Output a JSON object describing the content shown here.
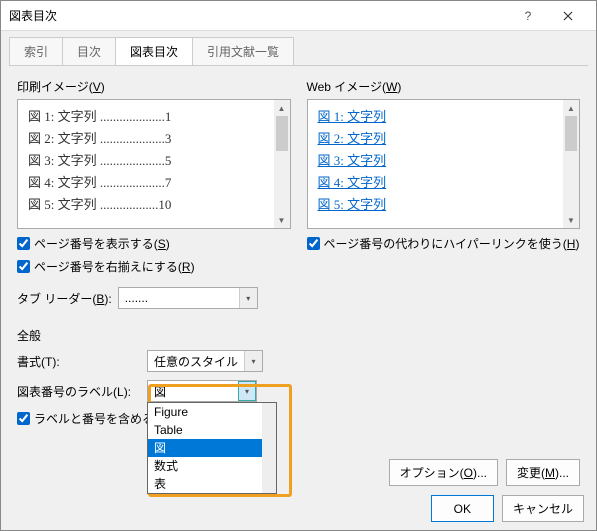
{
  "dialog": {
    "title": "図表目次"
  },
  "tabs": {
    "t1": "索引",
    "t2": "目次",
    "t3": "図表目次",
    "t4": "引用文献一覧"
  },
  "printPreview": {
    "label_pre": "印刷イメージ(",
    "label_u": "V",
    "label_post": ")",
    "lines": [
      "図 1: 文字列 ....................1",
      "図 2: 文字列 ....................3",
      "図 3: 文字列 ....................5",
      "図 4: 文字列 ....................7",
      "図 5: 文字列 ..................10"
    ]
  },
  "webPreview": {
    "label_pre": "Web イメージ(",
    "label_u": "W",
    "label_post": ")",
    "lines": [
      "図 1: 文字列",
      "図 2: 文字列",
      "図 3: 文字列",
      "図 4: 文字列",
      "図 5: 文字列"
    ]
  },
  "checks": {
    "showPage_pre": "ページ番号を表示する(",
    "showPage_u": "S",
    "showPage_post": ")",
    "rightAlign_pre": "ページ番号を右揃えにする(",
    "rightAlign_u": "R",
    "rightAlign_post": ")",
    "hyperlink_pre": "ページ番号の代わりにハイパーリンクを使う(",
    "hyperlink_u": "H",
    "hyperlink_post": ")"
  },
  "tabLeader": {
    "label_pre": "タブ リーダー(",
    "label_u": "B",
    "label_post": "):",
    "value": "......."
  },
  "general": {
    "title": "全般",
    "format_label_pre": "書式(",
    "format_label_u": "T",
    "format_label_post": "):",
    "format_value": "任意のスタイル",
    "caption_label_pre": "図表番号のラベル(",
    "caption_label_u": "L",
    "caption_label_post": "):",
    "caption_value": "図",
    "include_label": "ラベルと番号を含める",
    "caption_options": [
      "Figure",
      "Table",
      "図",
      "数式",
      "表"
    ]
  },
  "buttons": {
    "options_pre": "オプション(",
    "options_u": "O",
    "options_post": ")...",
    "modify_pre": "変更(",
    "modify_u": "M",
    "modify_post": ")...",
    "ok": "OK",
    "cancel": "キャンセル"
  }
}
